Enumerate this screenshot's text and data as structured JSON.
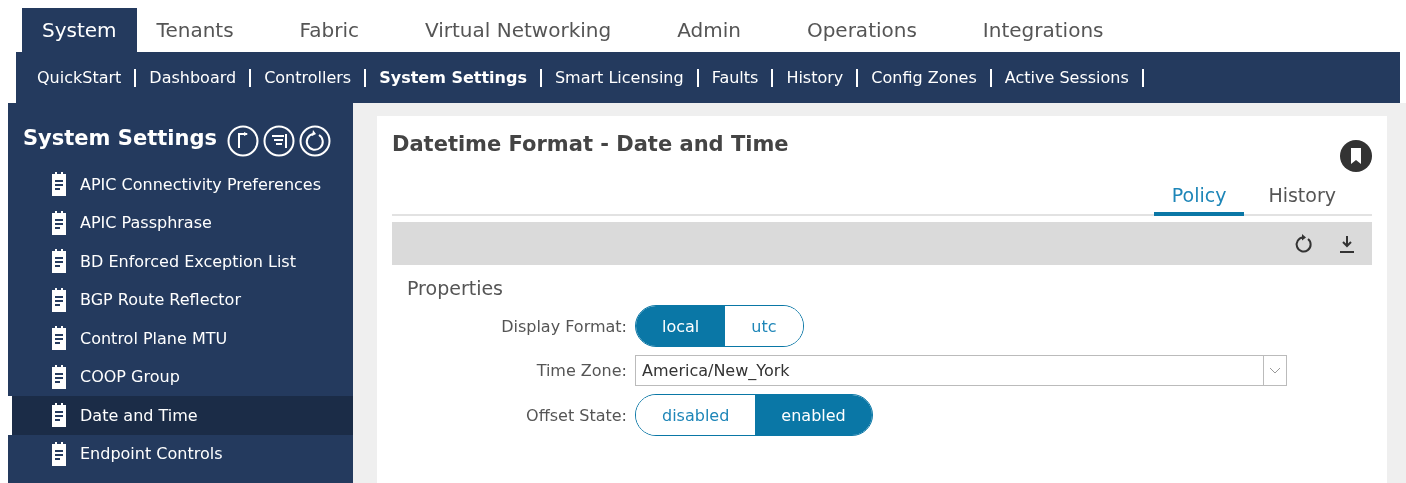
{
  "top_tabs": [
    {
      "label": "System",
      "selected": true
    },
    {
      "label": "Tenants",
      "selected": false
    },
    {
      "label": "Fabric",
      "selected": false
    },
    {
      "label": "Virtual Networking",
      "selected": false
    },
    {
      "label": "Admin",
      "selected": false
    },
    {
      "label": "Operations",
      "selected": false
    },
    {
      "label": "Integrations",
      "selected": false
    }
  ],
  "sub_nav": [
    {
      "label": "QuickStart",
      "selected": false
    },
    {
      "label": "Dashboard",
      "selected": false
    },
    {
      "label": "Controllers",
      "selected": false
    },
    {
      "label": "System Settings",
      "selected": true
    },
    {
      "label": "Smart Licensing",
      "selected": false
    },
    {
      "label": "Faults",
      "selected": false
    },
    {
      "label": "History",
      "selected": false
    },
    {
      "label": "Config Zones",
      "selected": false
    },
    {
      "label": "Active Sessions",
      "selected": false
    }
  ],
  "sidebar": {
    "title": "System Settings",
    "items": [
      {
        "label": "APIC Connectivity Preferences",
        "selected": false
      },
      {
        "label": "APIC Passphrase",
        "selected": false
      },
      {
        "label": "BD Enforced Exception List",
        "selected": false
      },
      {
        "label": "BGP Route Reflector",
        "selected": false
      },
      {
        "label": "Control Plane MTU",
        "selected": false
      },
      {
        "label": "COOP Group",
        "selected": false
      },
      {
        "label": "Date and Time",
        "selected": true
      },
      {
        "label": "Endpoint Controls",
        "selected": false
      }
    ]
  },
  "panel": {
    "title": "Datetime Format - Date and Time",
    "tabs": [
      {
        "label": "Policy",
        "selected": true
      },
      {
        "label": "History",
        "selected": false
      }
    ],
    "section": "Properties",
    "fields": [
      {
        "kind": "toggle",
        "label": "Display Format:",
        "options": [
          {
            "label": "local",
            "selected": true
          },
          {
            "label": "utc",
            "selected": false
          }
        ]
      },
      {
        "kind": "select",
        "label": "Time Zone:",
        "value": "America/New_York"
      },
      {
        "kind": "toggle",
        "label": "Offset State:",
        "options": [
          {
            "label": "disabled",
            "selected": false
          },
          {
            "label": "enabled",
            "selected": true
          }
        ]
      }
    ]
  }
}
